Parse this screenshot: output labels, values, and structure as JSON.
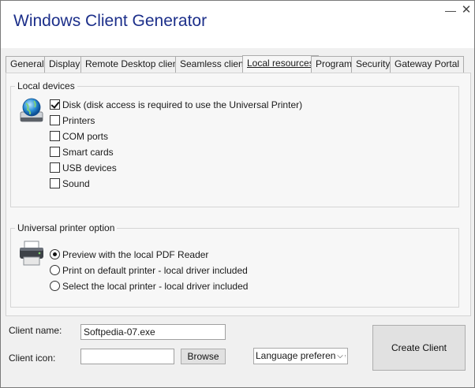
{
  "window": {
    "title": "Windows Client Generator",
    "minimize": "—",
    "close": "✕"
  },
  "tabs": [
    {
      "label": "General"
    },
    {
      "label": "Display"
    },
    {
      "label": "Remote Desktop client"
    },
    {
      "label": "Seamless client"
    },
    {
      "label": "Local resources",
      "active": true
    },
    {
      "label": "Program"
    },
    {
      "label": "Security"
    },
    {
      "label": "Gateway Portal"
    }
  ],
  "local_devices": {
    "legend": "Local devices",
    "icon": "globe-drive-icon",
    "items": [
      {
        "label": "Disk (disk access is required to use the Universal Printer)",
        "checked": true
      },
      {
        "label": "Printers",
        "checked": false
      },
      {
        "label": "COM ports",
        "checked": false
      },
      {
        "label": "Smart cards",
        "checked": false
      },
      {
        "label": "USB devices",
        "checked": false
      },
      {
        "label": "Sound",
        "checked": false
      }
    ]
  },
  "printer_option": {
    "legend": "Universal printer option",
    "icon": "printer-icon",
    "options": [
      {
        "label": "Preview with the local PDF Reader",
        "selected": true
      },
      {
        "label": "Print on default printer - local driver included",
        "selected": false
      },
      {
        "label": "Select the local printer - local driver included",
        "selected": false
      }
    ]
  },
  "footer": {
    "client_name_label": "Client name:",
    "client_name_value": "Softpedia-07.exe",
    "client_icon_label": "Client icon:",
    "client_icon_value": "",
    "browse_label": "Browse",
    "language_select": "Language preference",
    "create_label": "Create Client"
  },
  "colors": {
    "title": "#1c2f8a",
    "window_bg": "#f0f0f0",
    "panel_bg": "#f7f7f7"
  }
}
